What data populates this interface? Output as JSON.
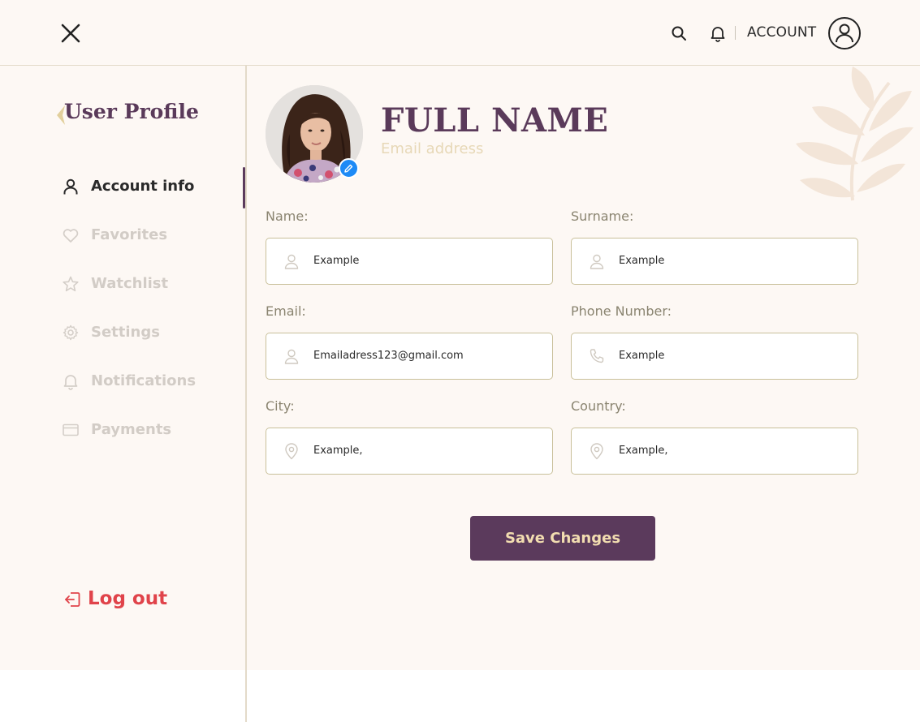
{
  "header": {
    "account_label": "ACCOUNT",
    "icons": [
      "close-icon",
      "search-icon",
      "bell-icon",
      "account-avatar-icon"
    ]
  },
  "sidebar": {
    "title": "User Profile",
    "items": [
      {
        "label": "Account info",
        "icon": "user-icon",
        "active": true
      },
      {
        "label": "Favorites",
        "icon": "heart-icon",
        "active": false
      },
      {
        "label": "Watchlist",
        "icon": "star-icon",
        "active": false
      },
      {
        "label": "Settings",
        "icon": "gear-icon",
        "active": false
      },
      {
        "label": "Notifications",
        "icon": "bell-icon",
        "active": false
      },
      {
        "label": "Payments",
        "icon": "credit-card-icon",
        "active": false
      }
    ],
    "logout_label": "Log out"
  },
  "profile": {
    "full_name": "FULL NAME",
    "email_placeholder": "Email address"
  },
  "form": {
    "fields": [
      {
        "label": "Name:",
        "value": "Example",
        "icon": "user-icon"
      },
      {
        "label": "Surname:",
        "value": "Example",
        "icon": "user-icon"
      },
      {
        "label": "Email:",
        "value": "Emailadress123@gmail.com",
        "icon": "user-icon"
      },
      {
        "label": "Phone Number:",
        "value": "Example",
        "icon": "phone-icon"
      },
      {
        "label": "City:",
        "value": "Example,",
        "icon": "location-pin-icon"
      },
      {
        "label": "Country:",
        "value": "Example,",
        "icon": "location-pin-icon"
      }
    ],
    "save_label": "Save Changes"
  },
  "colors": {
    "brand": "#5b3a5c",
    "accent_gold": "#f2ddb0",
    "background": "#fdf8f4",
    "logout_red": "#e0434a",
    "edit_blue": "#1d8af6"
  }
}
